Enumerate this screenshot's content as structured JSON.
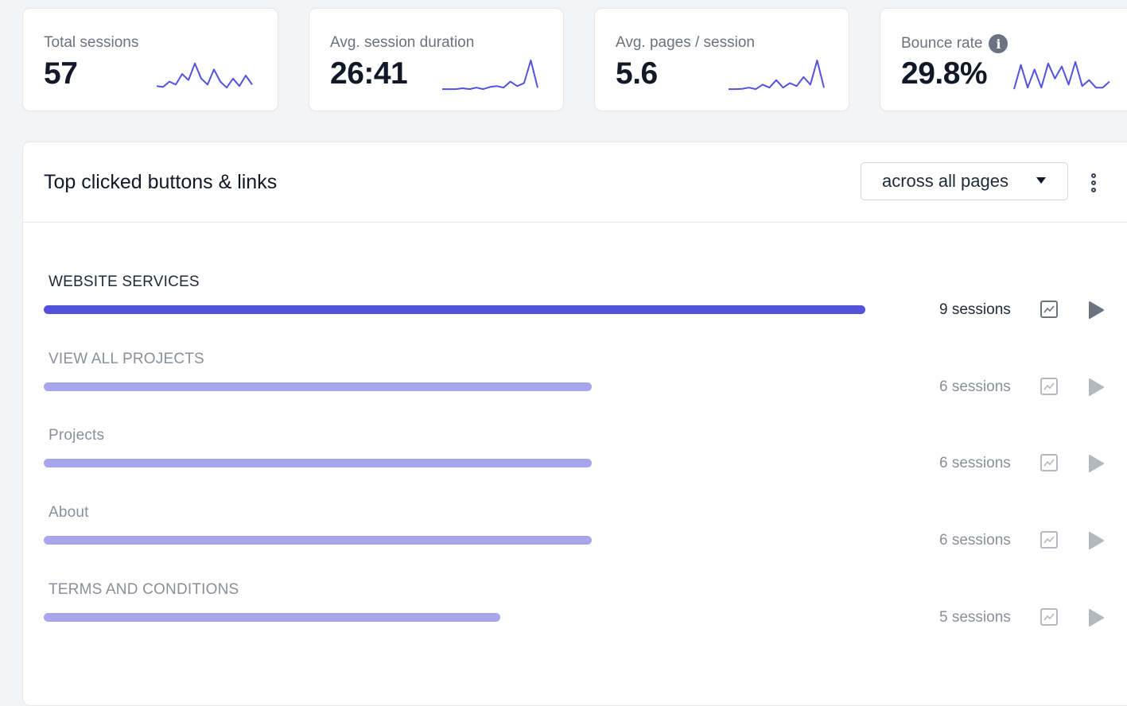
{
  "theme": {
    "accent_primary": "#5352dd",
    "accent_muted": "#a7a6ec",
    "text_active": "#1f2937",
    "text_muted": "#8a8f98",
    "icon_muted": "#b4b8bf"
  },
  "metrics": [
    {
      "label": "Total sessions",
      "value": "57",
      "sparkline": [
        0.15,
        0.12,
        0.3,
        0.2,
        0.55,
        0.35,
        0.9,
        0.4,
        0.2,
        0.7,
        0.3,
        0.1,
        0.4,
        0.15,
        0.5,
        0.2
      ]
    },
    {
      "label": "Avg. session duration",
      "value": "26:41",
      "sparkline": [
        0.05,
        0.05,
        0.05,
        0.08,
        0.05,
        0.1,
        0.05,
        0.12,
        0.15,
        0.1,
        0.3,
        0.15,
        0.25,
        1.0,
        0.1
      ]
    },
    {
      "label": "Avg. pages / session",
      "value": "5.6",
      "sparkline": [
        0.05,
        0.05,
        0.06,
        0.1,
        0.05,
        0.2,
        0.1,
        0.35,
        0.1,
        0.25,
        0.15,
        0.45,
        0.2,
        1.0,
        0.1
      ]
    },
    {
      "label": "Bounce rate",
      "value": "29.8%",
      "info_icon": "info-icon",
      "sparkline": [
        0.05,
        0.85,
        0.1,
        0.7,
        0.1,
        0.9,
        0.4,
        0.8,
        0.2,
        0.95,
        0.15,
        0.35,
        0.1,
        0.1,
        0.3
      ]
    }
  ],
  "panel": {
    "title": "Top clicked buttons & links",
    "scope_select": {
      "value": "across all pages",
      "icon": "caret-down-icon"
    },
    "menu_icon": "kebab-menu-icon",
    "rows": [
      {
        "label": "WEBSITE SERVICES",
        "sessions_label": "9 sessions",
        "value": 9,
        "active": true
      },
      {
        "label": "VIEW ALL PROJECTS",
        "sessions_label": "6 sessions",
        "value": 6,
        "active": false
      },
      {
        "label": "Projects",
        "sessions_label": "6 sessions",
        "value": 6,
        "active": false
      },
      {
        "label": "About",
        "sessions_label": "6 sessions",
        "value": 6,
        "active": false
      },
      {
        "label": "TERMS AND CONDITIONS",
        "sessions_label": "5 sessions",
        "value": 5,
        "active": false
      }
    ]
  }
}
